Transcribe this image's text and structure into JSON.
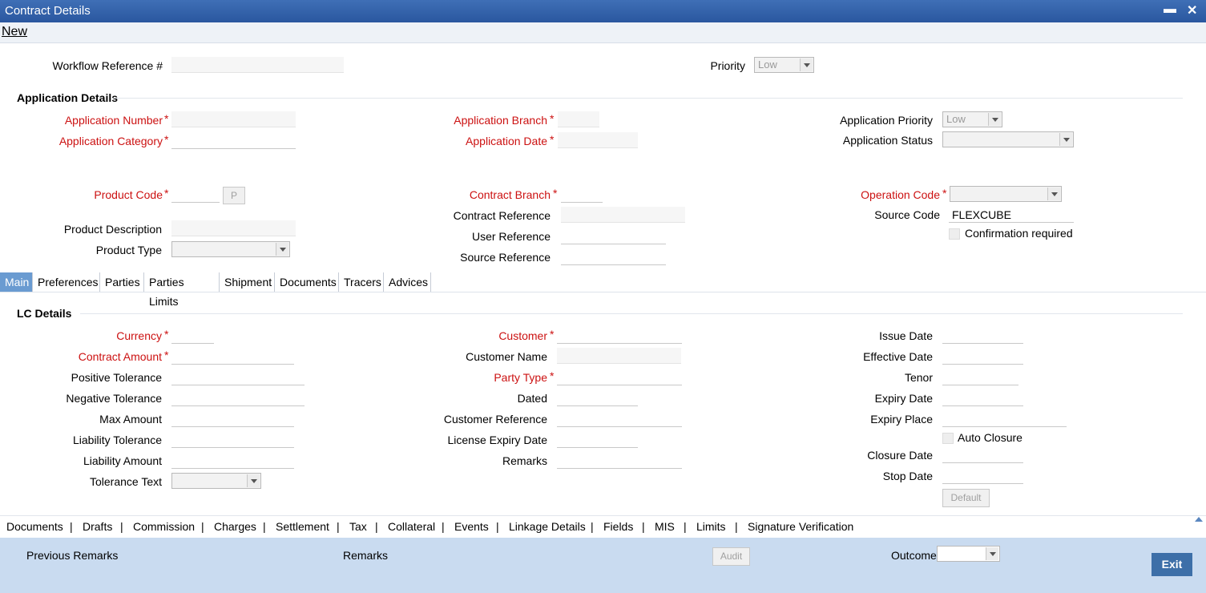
{
  "window": {
    "title": "Contract Details",
    "minimize": "▬",
    "close": "✕"
  },
  "menu": {
    "new": "New"
  },
  "top": {
    "workflow_ref_label": "Workflow Reference #",
    "workflow_ref_value": "",
    "priority_label": "Priority",
    "priority_value": "Low"
  },
  "application_details": {
    "heading": "Application Details",
    "app_number_label": "Application Number",
    "app_category_label": "Application Category",
    "app_branch_label": "Application Branch",
    "app_date_label": "Application Date",
    "app_priority_label": "Application Priority",
    "app_priority_value": "Low",
    "app_status_label": "Application Status",
    "app_status_value": "",
    "product_code_label": "Product Code",
    "product_code_button": "P",
    "product_desc_label": "Product Description",
    "product_type_label": "Product Type",
    "contract_branch_label": "Contract Branch",
    "contract_ref_label": "Contract Reference",
    "user_ref_label": "User Reference",
    "source_ref_label": "Source Reference",
    "operation_code_label": "Operation Code",
    "source_code_label": "Source Code",
    "source_code_value": "FLEXCUBE",
    "confirmation_label": "Confirmation required"
  },
  "tabs": [
    {
      "label": "Main",
      "active": true
    },
    {
      "label": "Preferences",
      "active": false
    },
    {
      "label": "Parties",
      "active": false
    },
    {
      "label": "Parties Limits",
      "active": false
    },
    {
      "label": "Shipment",
      "active": false
    },
    {
      "label": "Documents",
      "active": false
    },
    {
      "label": "Tracers",
      "active": false
    },
    {
      "label": "Advices",
      "active": false
    }
  ],
  "lc_details": {
    "heading": "LC Details",
    "currency_label": "Currency",
    "contract_amount_label": "Contract Amount",
    "positive_tol_label": "Positive Tolerance",
    "negative_tol_label": "Negative Tolerance",
    "max_amount_label": "Max Amount",
    "liability_tol_label": "Liability Tolerance",
    "liability_amount_label": "Liability Amount",
    "tolerance_text_label": "Tolerance Text",
    "customer_label": "Customer",
    "customer_name_label": "Customer Name",
    "party_type_label": "Party Type",
    "dated_label": "Dated",
    "customer_ref_label": "Customer Reference",
    "license_expiry_label": "License Expiry Date",
    "remarks_label": "Remarks",
    "issue_date_label": "Issue Date",
    "effective_date_label": "Effective Date",
    "tenor_label": "Tenor",
    "expiry_date_label": "Expiry Date",
    "expiry_place_label": "Expiry Place",
    "auto_closure_label": "Auto Closure",
    "closure_date_label": "Closure Date",
    "stop_date_label": "Stop Date",
    "default_button": "Default"
  },
  "sublinks": [
    "Documents",
    "Drafts",
    "Commission",
    "Charges",
    "Settlement",
    "Tax",
    "Collateral",
    "Events",
    "Linkage Details",
    "Fields",
    "MIS",
    "Limits",
    "Signature Verification"
  ],
  "separator": "|",
  "footer": {
    "previous_remarks": "Previous Remarks",
    "remarks": "Remarks",
    "audit": "Audit",
    "outcome_label": "Outcome",
    "exit": "Exit"
  },
  "colors": {
    "titlebar": "#2f5fa8",
    "required": "#cc1111",
    "footer": "#c9dbf0",
    "active_tab": "#6a9bd1",
    "exit_button": "#3d6fa8"
  }
}
